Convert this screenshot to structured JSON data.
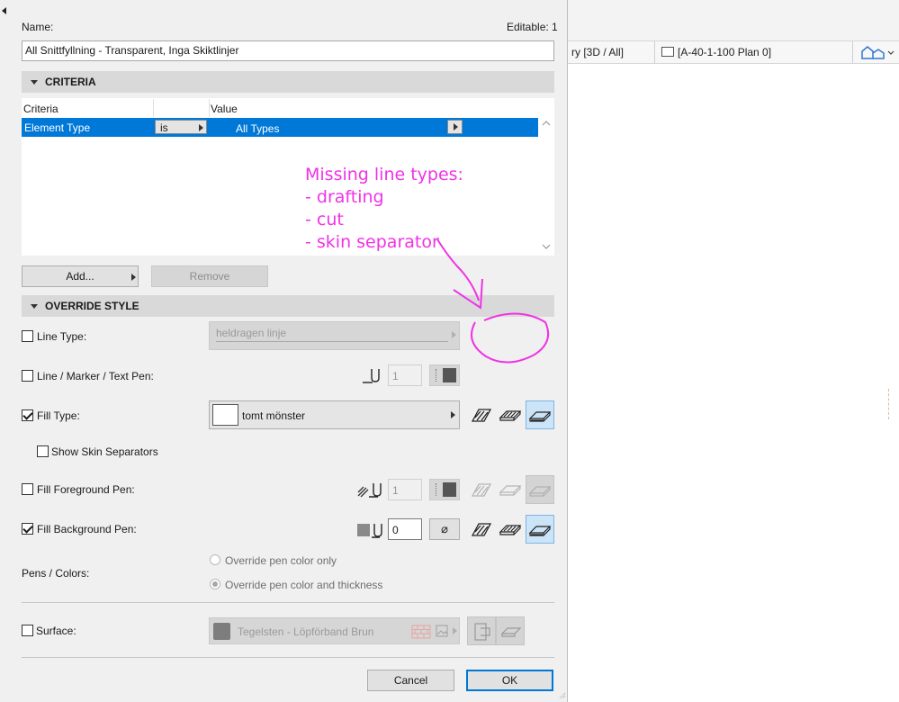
{
  "app": {
    "view_tabs": [
      {
        "label": "ry [3D / All]"
      },
      {
        "label": "[A-40-1-100 Plan 0]"
      }
    ]
  },
  "dialog": {
    "name_label": "Name:",
    "editable_label": "Editable: 1",
    "name_value": "All Snittfyllning - Transparent, Inga Skiktlinjer",
    "criteria_section": "CRITERIA",
    "criteria_table": {
      "columns": [
        "Criteria",
        "",
        "Value"
      ],
      "rows": [
        {
          "criteria": "Element Type",
          "operator": "is",
          "value": "All Types"
        }
      ]
    },
    "add_button": "Add...",
    "remove_button": "Remove",
    "override_section": "OVERRIDE STYLE",
    "line_type": {
      "label": "Line Type:",
      "checked": false,
      "value": "heldragen linje"
    },
    "line_pen": {
      "label": "Line / Marker / Text Pen:",
      "checked": false,
      "value": "1"
    },
    "fill_type": {
      "label": "Fill Type:",
      "checked": true,
      "value": "tomt mönster"
    },
    "show_skin_separators": {
      "label": "Show Skin Separators",
      "checked": false
    },
    "fill_fg_pen": {
      "label": "Fill Foreground Pen:",
      "checked": false,
      "value": "1"
    },
    "fill_bg_pen": {
      "label": "Fill Background Pen:",
      "checked": true,
      "value": "0",
      "empty_symbol": "⌀"
    },
    "pens_colors": {
      "label": "Pens / Colors:",
      "options": [
        "Override pen color only",
        "Override pen color and thickness"
      ],
      "selected_index": 1
    },
    "surface": {
      "label": "Surface:",
      "checked": false,
      "value": "Tegelsten - Löpförband Brun"
    },
    "cancel_button": "Cancel",
    "ok_button": "OK"
  },
  "annotation": {
    "lines": [
      "Missing line types:",
      "- drafting",
      "- cut",
      "- skin separator"
    ],
    "color": "#f032e6"
  },
  "colors": {
    "selection": "#0078d7",
    "section_header": "#d9d9d9",
    "dialog_bg": "#f0f0f0"
  }
}
